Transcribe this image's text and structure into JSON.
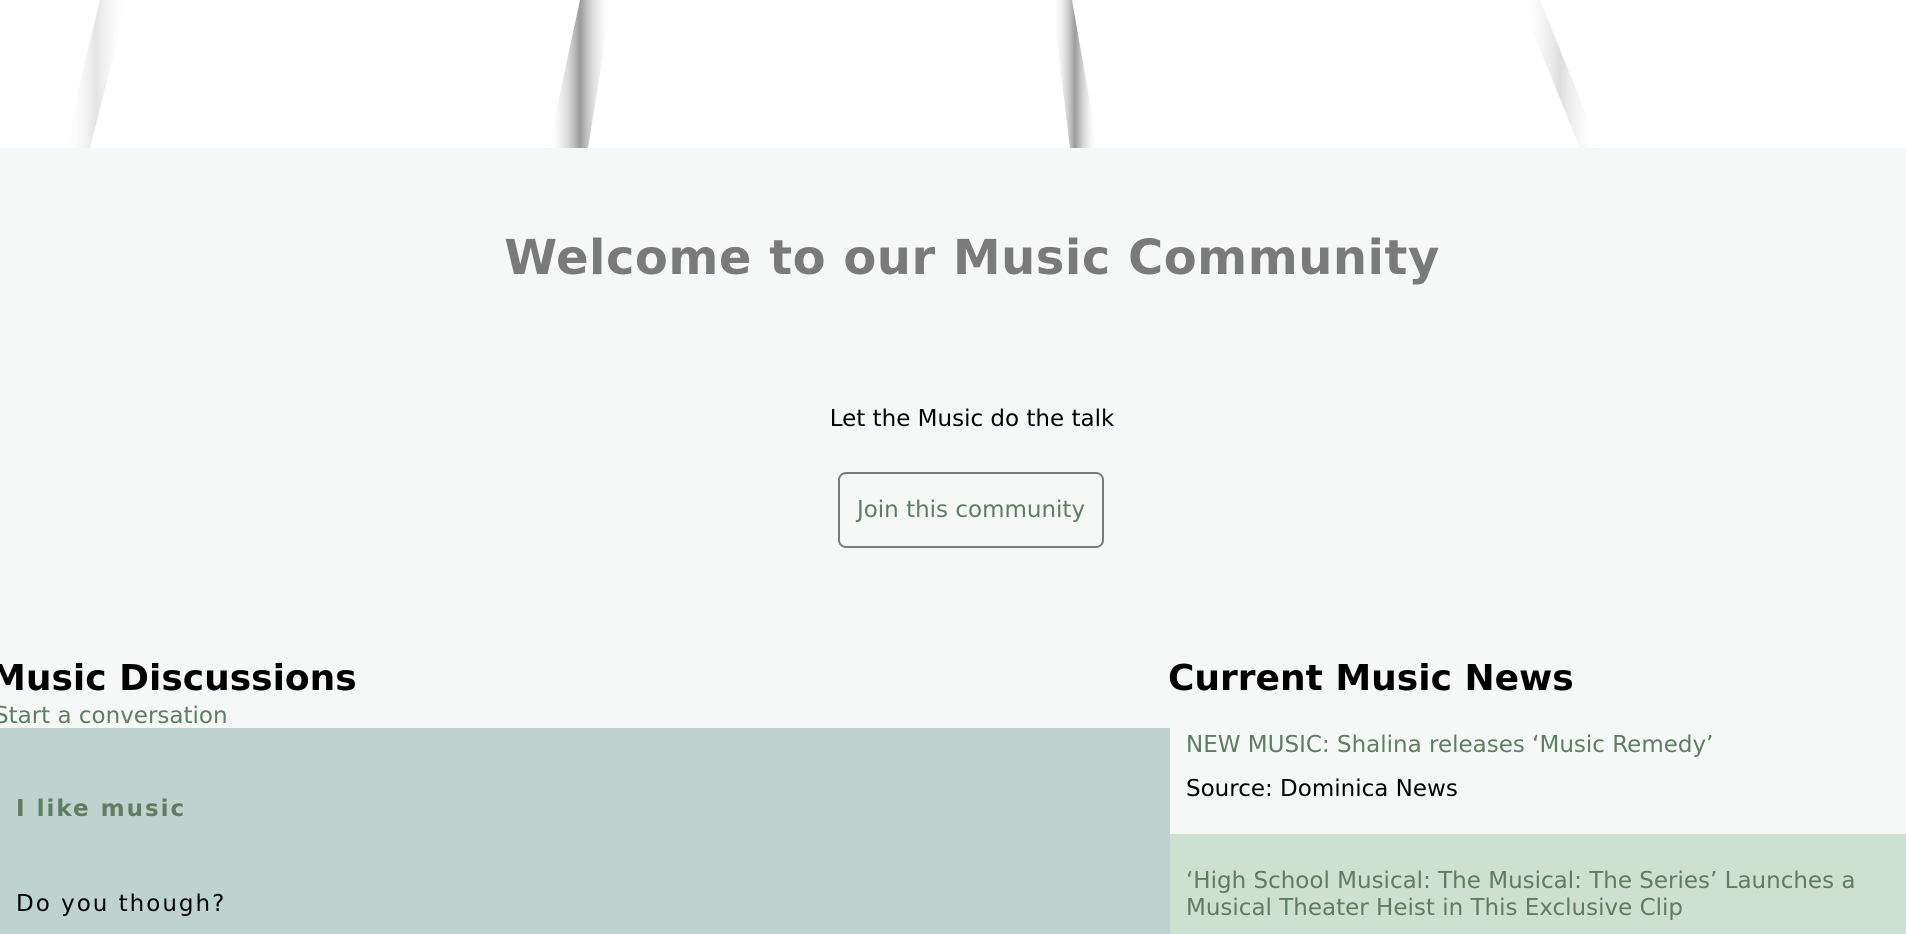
{
  "hero": {
    "image_alt": "piano keys"
  },
  "welcome": {
    "title": "Welcome to our Music Community",
    "tagline": "Let the Music do the talk",
    "join_label": "Join this community"
  },
  "discussions": {
    "title": "Music Discussions",
    "start_link": "Start a conversation",
    "posts": [
      {
        "title": "I like music",
        "body": "Do you though?"
      }
    ]
  },
  "news": {
    "title": "Current Music News",
    "items": [
      {
        "headline": "NEW MUSIC: Shalina releases ‘Music Remedy’",
        "source": "Source: Dominica News"
      },
      {
        "headline": "‘High School Musical: The Musical: The Series’ Launches a Musical Theater Heist in This Exclusive Clip"
      }
    ]
  },
  "colors": {
    "accent_green": "#5d7e61",
    "discussion_card_bg": "#bed2cf",
    "news_alt_bg": "#cde0d2",
    "page_bg": "#f6f8f7",
    "title_gray": "#7a7a7a"
  }
}
